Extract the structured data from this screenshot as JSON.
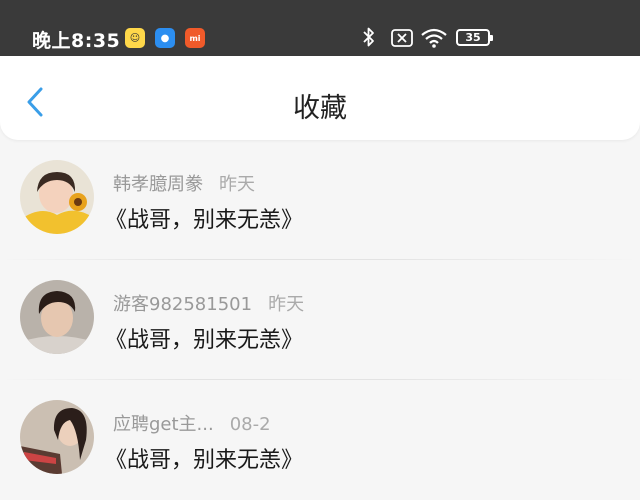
{
  "status_bar": {
    "time": "晚上8:35",
    "battery": "35",
    "apps": [
      {
        "name": "chat-app-icon",
        "glyph": "☺"
      },
      {
        "name": "message-app-icon",
        "glyph": "●"
      },
      {
        "name": "mi-app-icon",
        "glyph": "mi"
      }
    ]
  },
  "nav": {
    "title": "收藏"
  },
  "items": [
    {
      "author": "韩孝臆周豢",
      "time": "昨天",
      "title": "《战哥，别来无恙》"
    },
    {
      "author": "游客982581501",
      "time": "昨天",
      "title": "《战哥，别来无恙》"
    },
    {
      "author": "应聘get主...",
      "time": "08-2",
      "title": "《战哥，别来无恙》"
    }
  ],
  "colors": {
    "accent": "#3a9ee8",
    "status_bar_bg": "#3a3a3a"
  }
}
